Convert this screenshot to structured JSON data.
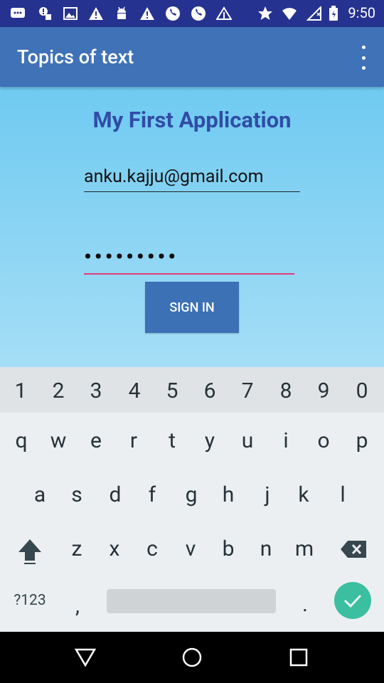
{
  "status_bar": {
    "time": "9:50",
    "left_icons": [
      "chat-icon",
      "notification-icon",
      "gallery-icon",
      "warning-icon",
      "android-icon",
      "warning-icon",
      "phone-icon",
      "phone-icon",
      "app-icon"
    ],
    "right_icons": [
      "star-icon",
      "wifi-icon",
      "no-sim-icon",
      "battery-icon"
    ]
  },
  "app_bar": {
    "title": "Topics of text"
  },
  "main": {
    "heading": "My First Application",
    "email_value": "anku.kajju@gmail.com",
    "password_value": "•••••••••",
    "signin_label": "SIGN IN"
  },
  "keyboard": {
    "numbers": [
      "1",
      "2",
      "3",
      "4",
      "5",
      "6",
      "7",
      "8",
      "9",
      "0"
    ],
    "row1": [
      "q",
      "w",
      "e",
      "r",
      "t",
      "y",
      "u",
      "i",
      "o",
      "p"
    ],
    "row2": [
      "a",
      "s",
      "d",
      "f",
      "g",
      "h",
      "j",
      "k",
      "l"
    ],
    "row3": [
      "z",
      "x",
      "c",
      "v",
      "b",
      "n",
      "m"
    ],
    "symbols_label": "?123",
    "comma": ",",
    "period": "."
  },
  "colors": {
    "status_bar": "#26328f",
    "app_bar": "#3f72b6",
    "accent": "#e5397b",
    "button": "#3c71b5",
    "enter": "#3bbfa0"
  }
}
